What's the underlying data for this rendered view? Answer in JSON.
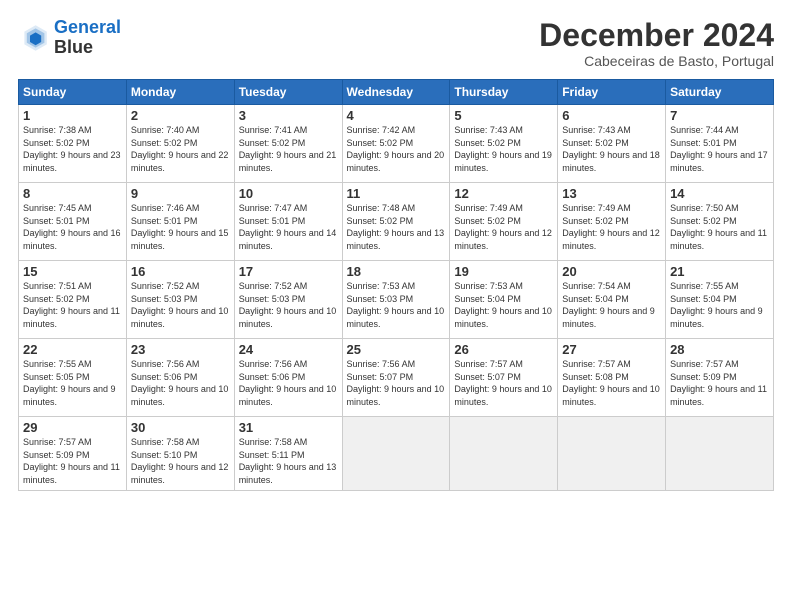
{
  "header": {
    "logo_line1": "General",
    "logo_line2": "Blue",
    "month_title": "December 2024",
    "subtitle": "Cabeceiras de Basto, Portugal"
  },
  "weekdays": [
    "Sunday",
    "Monday",
    "Tuesday",
    "Wednesday",
    "Thursday",
    "Friday",
    "Saturday"
  ],
  "weeks": [
    [
      {
        "day": "1",
        "sunrise": "Sunrise: 7:38 AM",
        "sunset": "Sunset: 5:02 PM",
        "daylight": "Daylight: 9 hours and 23 minutes."
      },
      {
        "day": "2",
        "sunrise": "Sunrise: 7:40 AM",
        "sunset": "Sunset: 5:02 PM",
        "daylight": "Daylight: 9 hours and 22 minutes."
      },
      {
        "day": "3",
        "sunrise": "Sunrise: 7:41 AM",
        "sunset": "Sunset: 5:02 PM",
        "daylight": "Daylight: 9 hours and 21 minutes."
      },
      {
        "day": "4",
        "sunrise": "Sunrise: 7:42 AM",
        "sunset": "Sunset: 5:02 PM",
        "daylight": "Daylight: 9 hours and 20 minutes."
      },
      {
        "day": "5",
        "sunrise": "Sunrise: 7:43 AM",
        "sunset": "Sunset: 5:02 PM",
        "daylight": "Daylight: 9 hours and 19 minutes."
      },
      {
        "day": "6",
        "sunrise": "Sunrise: 7:43 AM",
        "sunset": "Sunset: 5:02 PM",
        "daylight": "Daylight: 9 hours and 18 minutes."
      },
      {
        "day": "7",
        "sunrise": "Sunrise: 7:44 AM",
        "sunset": "Sunset: 5:01 PM",
        "daylight": "Daylight: 9 hours and 17 minutes."
      }
    ],
    [
      {
        "day": "8",
        "sunrise": "Sunrise: 7:45 AM",
        "sunset": "Sunset: 5:01 PM",
        "daylight": "Daylight: 9 hours and 16 minutes."
      },
      {
        "day": "9",
        "sunrise": "Sunrise: 7:46 AM",
        "sunset": "Sunset: 5:01 PM",
        "daylight": "Daylight: 9 hours and 15 minutes."
      },
      {
        "day": "10",
        "sunrise": "Sunrise: 7:47 AM",
        "sunset": "Sunset: 5:01 PM",
        "daylight": "Daylight: 9 hours and 14 minutes."
      },
      {
        "day": "11",
        "sunrise": "Sunrise: 7:48 AM",
        "sunset": "Sunset: 5:02 PM",
        "daylight": "Daylight: 9 hours and 13 minutes."
      },
      {
        "day": "12",
        "sunrise": "Sunrise: 7:49 AM",
        "sunset": "Sunset: 5:02 PM",
        "daylight": "Daylight: 9 hours and 12 minutes."
      },
      {
        "day": "13",
        "sunrise": "Sunrise: 7:49 AM",
        "sunset": "Sunset: 5:02 PM",
        "daylight": "Daylight: 9 hours and 12 minutes."
      },
      {
        "day": "14",
        "sunrise": "Sunrise: 7:50 AM",
        "sunset": "Sunset: 5:02 PM",
        "daylight": "Daylight: 9 hours and 11 minutes."
      }
    ],
    [
      {
        "day": "15",
        "sunrise": "Sunrise: 7:51 AM",
        "sunset": "Sunset: 5:02 PM",
        "daylight": "Daylight: 9 hours and 11 minutes."
      },
      {
        "day": "16",
        "sunrise": "Sunrise: 7:52 AM",
        "sunset": "Sunset: 5:03 PM",
        "daylight": "Daylight: 9 hours and 10 minutes."
      },
      {
        "day": "17",
        "sunrise": "Sunrise: 7:52 AM",
        "sunset": "Sunset: 5:03 PM",
        "daylight": "Daylight: 9 hours and 10 minutes."
      },
      {
        "day": "18",
        "sunrise": "Sunrise: 7:53 AM",
        "sunset": "Sunset: 5:03 PM",
        "daylight": "Daylight: 9 hours and 10 minutes."
      },
      {
        "day": "19",
        "sunrise": "Sunrise: 7:53 AM",
        "sunset": "Sunset: 5:04 PM",
        "daylight": "Daylight: 9 hours and 10 minutes."
      },
      {
        "day": "20",
        "sunrise": "Sunrise: 7:54 AM",
        "sunset": "Sunset: 5:04 PM",
        "daylight": "Daylight: 9 hours and 9 minutes."
      },
      {
        "day": "21",
        "sunrise": "Sunrise: 7:55 AM",
        "sunset": "Sunset: 5:04 PM",
        "daylight": "Daylight: 9 hours and 9 minutes."
      }
    ],
    [
      {
        "day": "22",
        "sunrise": "Sunrise: 7:55 AM",
        "sunset": "Sunset: 5:05 PM",
        "daylight": "Daylight: 9 hours and 9 minutes."
      },
      {
        "day": "23",
        "sunrise": "Sunrise: 7:56 AM",
        "sunset": "Sunset: 5:06 PM",
        "daylight": "Daylight: 9 hours and 10 minutes."
      },
      {
        "day": "24",
        "sunrise": "Sunrise: 7:56 AM",
        "sunset": "Sunset: 5:06 PM",
        "daylight": "Daylight: 9 hours and 10 minutes."
      },
      {
        "day": "25",
        "sunrise": "Sunrise: 7:56 AM",
        "sunset": "Sunset: 5:07 PM",
        "daylight": "Daylight: 9 hours and 10 minutes."
      },
      {
        "day": "26",
        "sunrise": "Sunrise: 7:57 AM",
        "sunset": "Sunset: 5:07 PM",
        "daylight": "Daylight: 9 hours and 10 minutes."
      },
      {
        "day": "27",
        "sunrise": "Sunrise: 7:57 AM",
        "sunset": "Sunset: 5:08 PM",
        "daylight": "Daylight: 9 hours and 10 minutes."
      },
      {
        "day": "28",
        "sunrise": "Sunrise: 7:57 AM",
        "sunset": "Sunset: 5:09 PM",
        "daylight": "Daylight: 9 hours and 11 minutes."
      }
    ],
    [
      {
        "day": "29",
        "sunrise": "Sunrise: 7:57 AM",
        "sunset": "Sunset: 5:09 PM",
        "daylight": "Daylight: 9 hours and 11 minutes."
      },
      {
        "day": "30",
        "sunrise": "Sunrise: 7:58 AM",
        "sunset": "Sunset: 5:10 PM",
        "daylight": "Daylight: 9 hours and 12 minutes."
      },
      {
        "day": "31",
        "sunrise": "Sunrise: 7:58 AM",
        "sunset": "Sunset: 5:11 PM",
        "daylight": "Daylight: 9 hours and 13 minutes."
      },
      null,
      null,
      null,
      null
    ]
  ]
}
